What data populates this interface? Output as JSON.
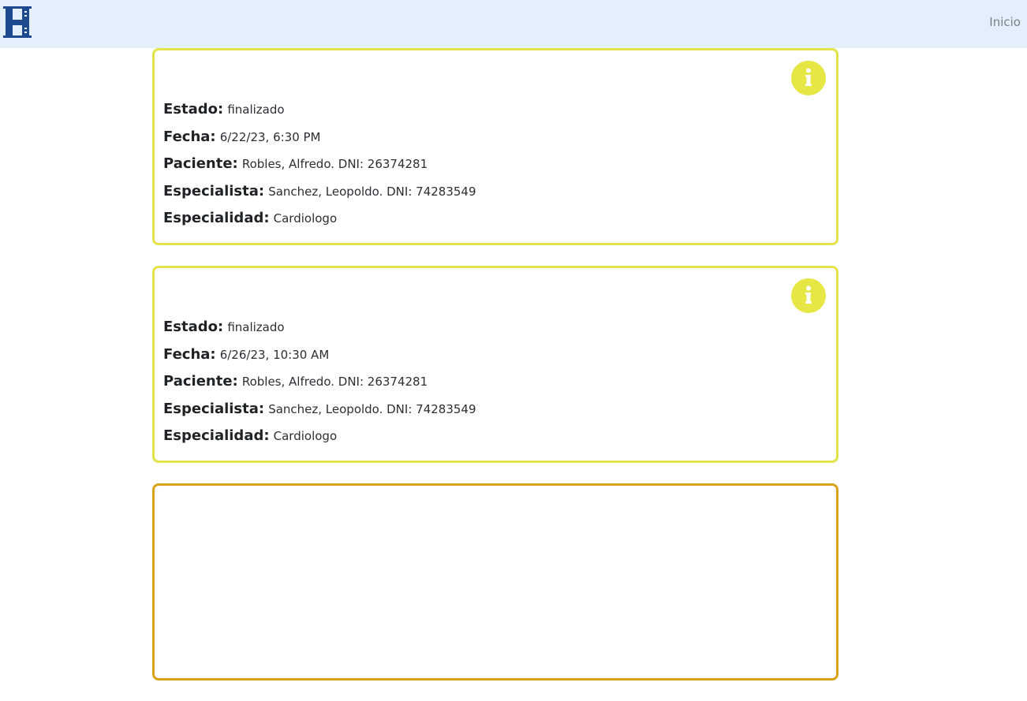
{
  "navbar": {
    "logo_letter": "H",
    "inicio_label": "Inicio"
  },
  "turnos": [
    {
      "estado_label": "Estado:",
      "estado": "finalizado",
      "fecha_label": "Fecha:",
      "fecha": "6/22/23, 6:30 PM",
      "paciente_label": "Paciente:",
      "paciente": "Robles, Alfredo. DNI: 26374281",
      "especialista_label": "Especialista:",
      "especialista": "Sanchez, Leopoldo. DNI: 74283549",
      "especialidad_label": "Especialidad:",
      "especialidad": "Cardiologo"
    },
    {
      "estado_label": "Estado:",
      "estado": "finalizado",
      "fecha_label": "Fecha:",
      "fecha": "6/26/23, 10:30 AM",
      "paciente_label": "Paciente:",
      "paciente": "Robles, Alfredo. DNI: 26374281",
      "especialista_label": "Especialista:",
      "especialista": "Sanchez, Leopoldo. DNI: 74283549",
      "especialidad_label": "Especialidad:",
      "especialidad": "Cardiologo"
    }
  ],
  "colors": {
    "navbar_bg": "#e3f0fc",
    "logo_blue": "#1f4a8f",
    "card_border_finalizado": "#e3e34b",
    "card_border_third": "#d9a21a",
    "info_icon_bg": "#e6e644"
  },
  "icons": {
    "info": "info-icon",
    "logo": "hospital-h-logo"
  }
}
